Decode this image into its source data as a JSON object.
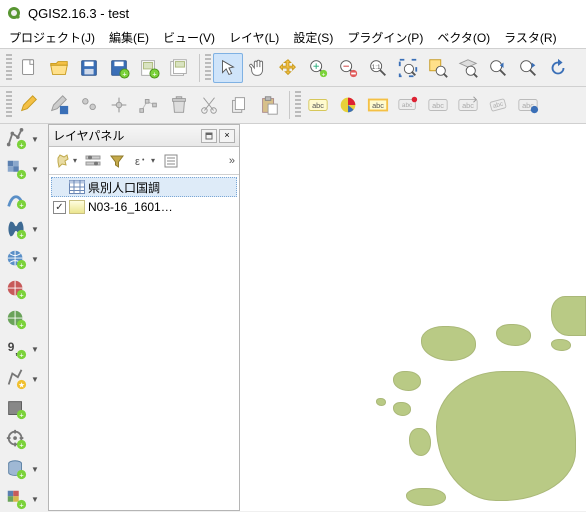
{
  "window": {
    "title": "QGIS2.16.3 - test"
  },
  "menu": {
    "items": [
      "プロジェクト(J)",
      "編集(E)",
      "ビュー(V)",
      "レイヤ(L)",
      "設定(S)",
      "プラグイン(P)",
      "ベクタ(O)",
      "ラスタ(R)"
    ]
  },
  "layers_panel": {
    "title": "レイヤパネル",
    "expand_chevron": "»",
    "layers": [
      {
        "name": "県別人口国調",
        "selected": true,
        "checked": true
      },
      {
        "name": "N03-16_1601…",
        "selected": false,
        "checked": true
      }
    ]
  },
  "colors": {
    "accent": "#7fb1e3",
    "land": "#b9ca85"
  }
}
